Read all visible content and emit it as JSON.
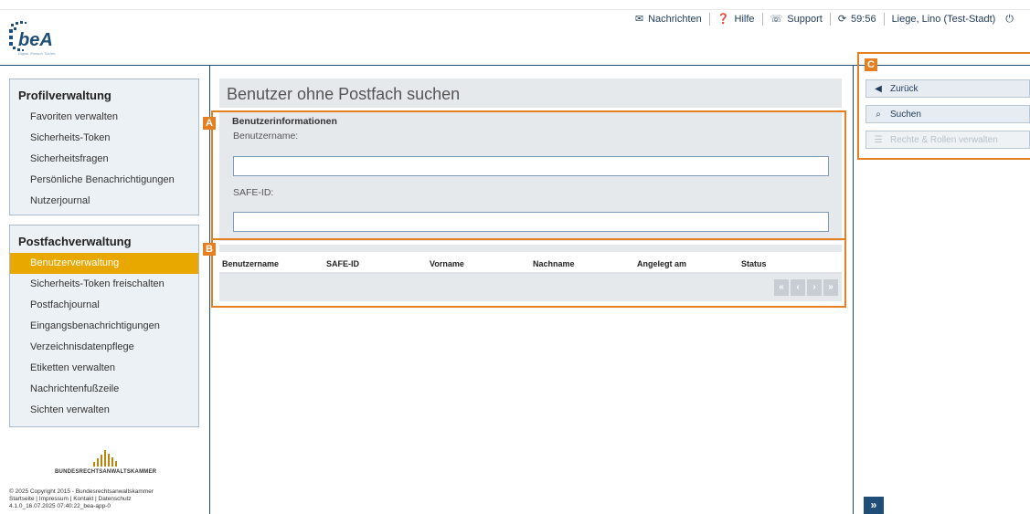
{
  "app": {
    "logo_text": "beA",
    "logo_tagline": "Digital. Einfach. Sicher."
  },
  "topnav": {
    "messages": "Nachrichten",
    "help": "Hilfe",
    "support": "Support",
    "session_timer": "59:56",
    "user": "Liege, Lino (Test-Stadt)"
  },
  "sidebar": {
    "profile": {
      "title": "Profilverwaltung",
      "items": [
        "Favoriten verwalten",
        "Sicherheits-Token",
        "Sicherheitsfragen",
        "Persönliche Benachrichtigungen",
        "Nutzerjournal"
      ]
    },
    "mailbox": {
      "title": "Postfachverwaltung",
      "items": [
        "Benutzerverwaltung",
        "Sicherheits-Token freischalten",
        "Postfachjournal",
        "Eingangsbenachrichtigungen",
        "Verzeichnisdatenpflege",
        "Etiketten verwalten",
        "Nachrichtenfußzeile",
        "Sichten verwalten"
      ],
      "active_index": 0
    }
  },
  "footer": {
    "brand": "BUNDESRECHTSANWALTSKAMMER",
    "copyright": "© 2025 Copyright 2015 - Bundesrechtsanwaltskammer",
    "links": "Startseite | Impressum | Kontakt | Datenschutz",
    "version": "4.1.0_16.07.2025 07:40:22_bea-app-0"
  },
  "main": {
    "page_title": "Benutzer ohne Postfach suchen",
    "section_title": "Benutzerinformationen",
    "username_label": "Benutzername:",
    "username_value": "",
    "safeid_label": "SAFE-ID:",
    "safeid_value": "",
    "table_columns": [
      "Benutzername",
      "SAFE-ID",
      "Vorname",
      "Nachname",
      "Angelegt am",
      "Status"
    ],
    "pager": [
      "«",
      "‹",
      "›",
      "»"
    ]
  },
  "annotations": [
    "A",
    "B",
    "C"
  ],
  "actions": {
    "back": "Zurück",
    "search": "Suchen",
    "rights": "Rechte & Rollen verwalten",
    "expand": "»"
  },
  "colors": {
    "accent": "#e8a800",
    "brand": "#1f4e79",
    "annotation": "#e67e22"
  }
}
